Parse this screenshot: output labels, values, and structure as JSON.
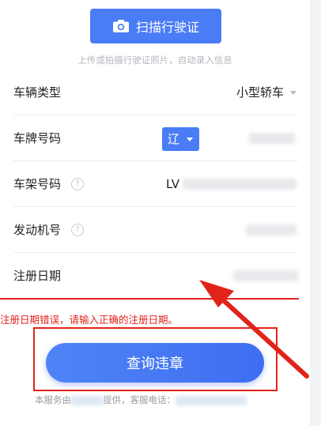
{
  "scan": {
    "label": "扫描行驶证",
    "icon": "camera-icon"
  },
  "hint": "上传或拍摄行驶证照片，自动录入信息",
  "form": {
    "vehicle_type": {
      "label": "车辆类型",
      "value": "小型轿车"
    },
    "plate": {
      "label": "车牌号码",
      "province": "辽"
    },
    "vin": {
      "label": "车架号码",
      "prefix": "LV",
      "help": "?"
    },
    "engine": {
      "label": "发动机号",
      "help": "?"
    },
    "reg_date": {
      "label": "注册日期"
    }
  },
  "error": "注册日期错误，请输入正确的注册日期。",
  "query_button": "查询违章",
  "footer": {
    "part1": "本服务由",
    "part2": "提供，客服电话："
  },
  "colors": {
    "accent": "#4a7cf6",
    "error": "#e2231a"
  }
}
